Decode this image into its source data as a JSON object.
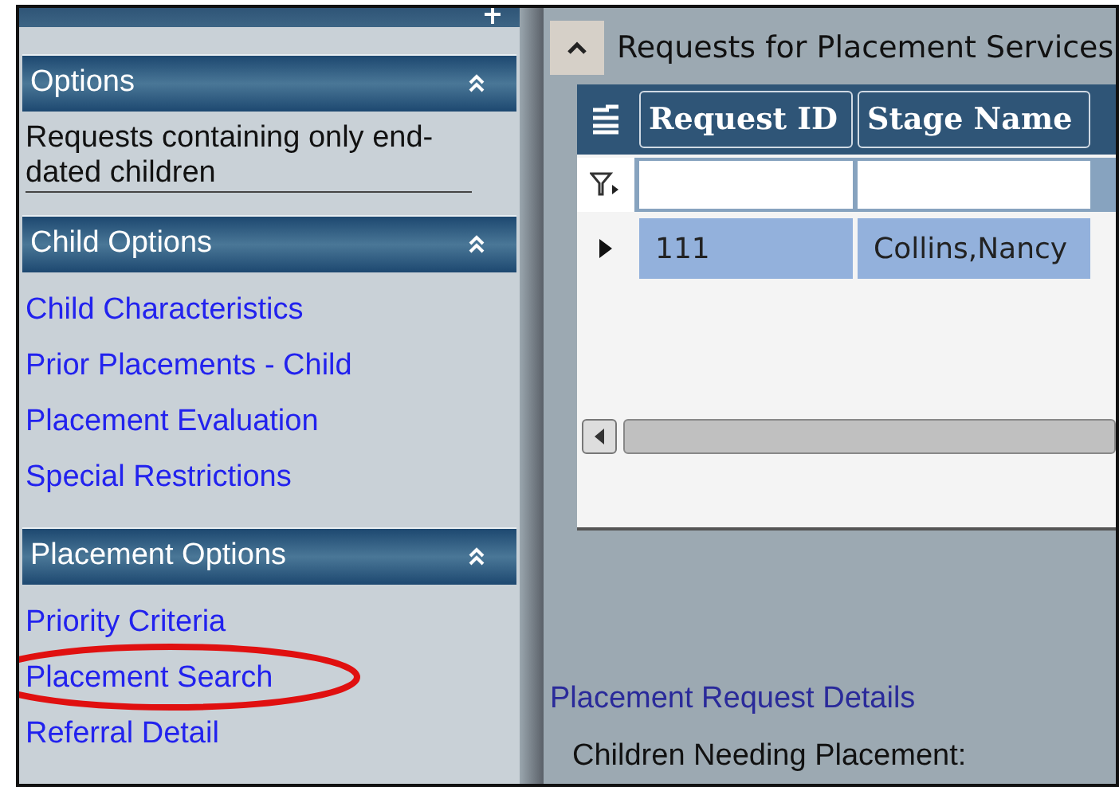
{
  "sidebar": {
    "sections": [
      {
        "title": "Options",
        "kind": "text",
        "items": [
          {
            "label": "Requests containing only end-dated children"
          }
        ]
      },
      {
        "title": "Child Options",
        "kind": "links",
        "items": [
          {
            "label": "Child Characteristics"
          },
          {
            "label": "Prior Placements - Child"
          },
          {
            "label": "Placement Evaluation"
          },
          {
            "label": "Special Restrictions"
          }
        ]
      },
      {
        "title": "Placement Options",
        "kind": "links",
        "items": [
          {
            "label": "Priority Criteria"
          },
          {
            "label": "Placement Search"
          },
          {
            "label": "Referral Detail"
          }
        ]
      }
    ]
  },
  "panel": {
    "title": "Requests for Placement Services",
    "expanded": true,
    "table": {
      "columns": [
        "Request ID",
        "Stage Name"
      ],
      "rows": [
        {
          "cells": [
            "111",
            "Collins,Nancy"
          ],
          "selected": true
        }
      ]
    }
  },
  "details": {
    "link": "Placement Request Details",
    "label": "Children Needing Placement:"
  }
}
